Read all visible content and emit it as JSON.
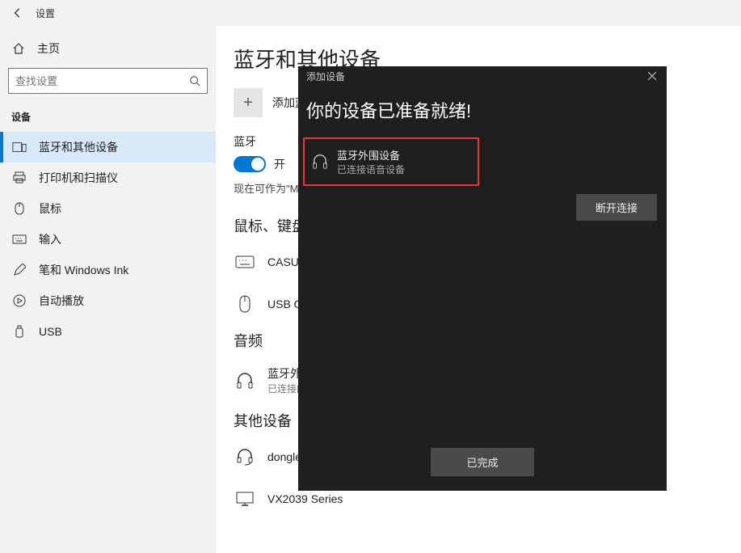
{
  "titlebar": {
    "title": "设置"
  },
  "sidebar": {
    "home": "主页",
    "search_placeholder": "查找设置",
    "category": "设备",
    "items": [
      {
        "label": "蓝牙和其他设备"
      },
      {
        "label": "打印机和扫描仪"
      },
      {
        "label": "鼠标"
      },
      {
        "label": "输入"
      },
      {
        "label": "笔和 Windows Ink"
      },
      {
        "label": "自动播放"
      },
      {
        "label": "USB"
      }
    ]
  },
  "page": {
    "title": "蓝牙和其他设备",
    "add_label": "添加蓝牙",
    "bt_label": "蓝牙",
    "toggle_state": "开",
    "discoverable": "现在可作为\"MKT",
    "section_mouse": "鼠标、键盘和",
    "dev_keyboard": "CASUE U",
    "dev_mouse": "USB OPT",
    "section_audio": "音频",
    "dev_audio_name": "蓝牙外围",
    "dev_audio_sub": "已连接的",
    "section_other": "其他设备",
    "dev_dongle": "dongle",
    "dev_monitor": "VX2039 Series"
  },
  "dialog": {
    "header": "添加设备",
    "title": "你的设备已准备就绪!",
    "device_name": "蓝牙外围设备",
    "device_sub": "已连接语音设备",
    "disconnect": "断开连接",
    "done": "已完成"
  }
}
